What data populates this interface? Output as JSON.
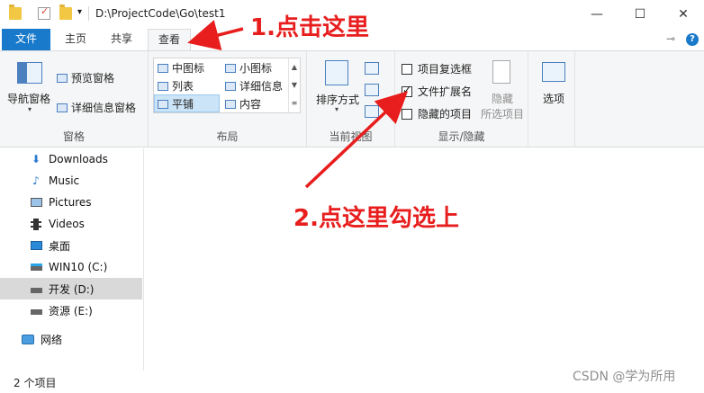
{
  "titlebar": {
    "path": "D:\\ProjectCode\\Go\\test1",
    "dropdown": "▾",
    "minimize": "—",
    "maximize": "☐",
    "close": "✕"
  },
  "tabs": {
    "file": "文件",
    "home": "主页",
    "share": "共享",
    "view": "查看",
    "pin": "⊸",
    "expand": "⌄",
    "help": "?"
  },
  "ribbon": {
    "panes": {
      "label": "窗格",
      "nav_pane": "导航窗格",
      "preview_pane": "预览窗格",
      "details_pane": "详细信息窗格"
    },
    "layout": {
      "label": "布局",
      "medium_icons": "中图标",
      "small_icons": "小图标",
      "list": "列表",
      "details": "详细信息",
      "tiles": "平铺",
      "content": "内容"
    },
    "current_view": {
      "label": "当前视图",
      "sort_by": "排序方式"
    },
    "show_hide": {
      "label": "显示/隐藏",
      "item_checkboxes": "项目复选框",
      "item_checkboxes_checked": false,
      "file_extensions": "文件扩展名",
      "file_extensions_checked": true,
      "hidden_items": "隐藏的项目",
      "hidden_items_checked": false,
      "hide_selected_l1": "隐藏",
      "hide_selected_l2": "所选项目"
    },
    "options": {
      "label": "选项"
    }
  },
  "nav": {
    "items": [
      {
        "label": "Downloads"
      },
      {
        "label": "Music"
      },
      {
        "label": "Pictures"
      },
      {
        "label": "Videos"
      },
      {
        "label": "桌面"
      },
      {
        "label": "WIN10 (C:)"
      },
      {
        "label": "开发 (D:)"
      },
      {
        "label": "资源 (E:)"
      },
      {
        "label": "网络"
      }
    ]
  },
  "status": {
    "count": "2 个项目"
  },
  "watermark": "CSDN @学为所用",
  "annotations": {
    "step1": "1.点击这里",
    "step2": "2.点这里勾选上",
    "color": "#e81d1d"
  },
  "colors": {
    "accent": "#1979ca",
    "ribbon_bg": "#f5f6f7",
    "selected_nav": "#d9d9d9",
    "selected_tile": "#cce4f7"
  }
}
